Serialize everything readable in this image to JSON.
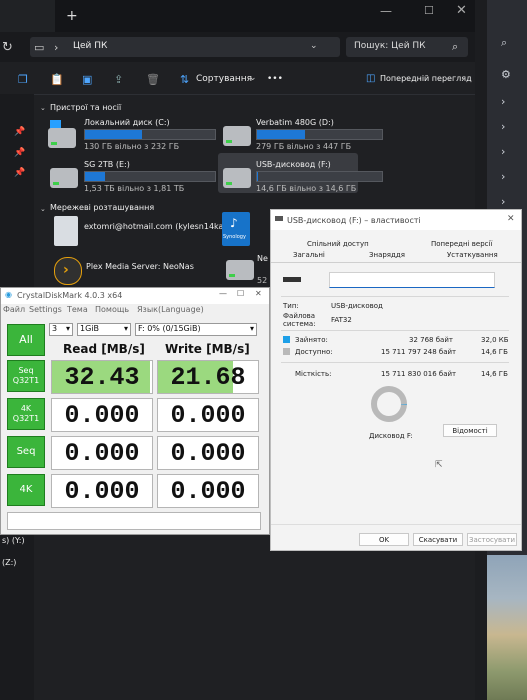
{
  "explorer": {
    "path": "Цей ПК",
    "search_placeholder": "Пошук: Цей ПК",
    "sort_label": "Сортування",
    "more_label": "•••",
    "preview_label": "Попередній перегляд",
    "section_devices": "Пристрої та носії",
    "section_network": "Мережеві розташування",
    "drives": [
      {
        "name": "Локальний диск (C:)",
        "free": "130 ГБ вільно з 232 ГБ",
        "fill": 0.44
      },
      {
        "name": "Verbatim 480G (D:)",
        "free": "279 ГБ вільно з 447 ГБ",
        "fill": 0.38
      },
      {
        "name": "SG 2TB (E:)",
        "free": "1,53 ТБ вільно з 1,81 ТБ",
        "fill": 0.15
      },
      {
        "name": "USB-дисковод (F:)",
        "free": "14,6 ГБ вільно з 14,6 ГБ",
        "fill": 0.01
      }
    ],
    "network": [
      {
        "name": "extomri@hotmail.com (kylesn14ka)"
      },
      {
        "name": "Plex Media Server: NeoNas"
      },
      {
        "name": "Ne"
      }
    ],
    "synology_label": "Synology",
    "left_items": [
      {
        "label": "s) (Y:)"
      },
      {
        "label": "(Z:)"
      }
    ],
    "partial_free": "52"
  },
  "crystal": {
    "title": "CrystalDiskMark 4.0.3 x64",
    "menu": [
      "Файл",
      "Settings",
      "Тема",
      "Помощь",
      "Язык(Language)"
    ],
    "runs": "3",
    "size": "1GiB",
    "drive": "F: 0% (0/15GiB)",
    "all_label": "All",
    "read_header": "Read [MB/s]",
    "write_header": "Write [MB/s]",
    "tests": [
      {
        "label": "Seq\nQ32T1",
        "read": "32.43",
        "write": "21.68",
        "read_frac": 0.98,
        "write_frac": 0.75
      },
      {
        "label": "4K\nQ32T1",
        "read": "0.000",
        "write": "0.000",
        "read_frac": 0,
        "write_frac": 0
      },
      {
        "label": "Seq",
        "read": "0.000",
        "write": "0.000",
        "read_frac": 0,
        "write_frac": 0
      },
      {
        "label": "4K",
        "read": "0.000",
        "write": "0.000",
        "read_frac": 0,
        "write_frac": 0
      }
    ]
  },
  "props": {
    "title": "USB-дисковод (F:) – властивості",
    "tabs_row1": [
      "Спільний доступ",
      "Попередні версії"
    ],
    "tabs_row2": [
      "Загальні",
      "Знаряддя",
      "Устаткування"
    ],
    "type_label": "Тип:",
    "type_value": "USB-дисковод",
    "fs_label": "Файлова система:",
    "fs_value": "FAT32",
    "used_label": "Зайнято:",
    "used_bytes": "32 768 байт",
    "used_size": "32,0 КБ",
    "free_label": "Доступно:",
    "free_bytes": "15 711 797 248 байт",
    "free_size": "14,6 ГБ",
    "cap_label": "Місткість:",
    "cap_bytes": "15 711 830 016 байт",
    "cap_size": "14,6 ГБ",
    "disk_label": "Дисковод F:",
    "details_btn": "Відомості",
    "ok_btn": "OK",
    "cancel_btn": "Скасувати",
    "apply_btn": "Застосувати",
    "used_color": "#1ea0e8",
    "free_color": "#b9b9b9"
  },
  "colors": {
    "accent": "#1e78d6",
    "cdm_green": "#3bb53b"
  }
}
